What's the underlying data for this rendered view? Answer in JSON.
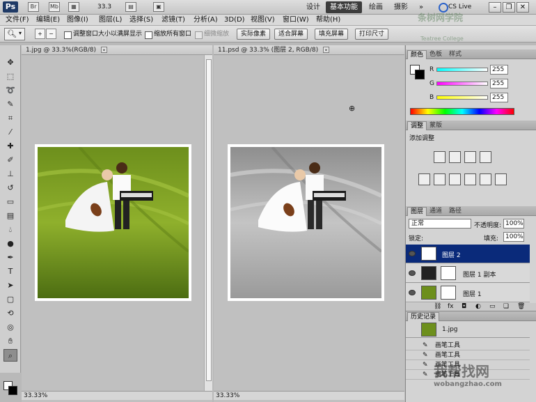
{
  "app": {
    "logo": "Ps",
    "br_icon": "Br",
    "mb_icon": "Mb",
    "zoom": "33.3",
    "workspaces": [
      "设计",
      "基本功能",
      "绘画",
      "摄影"
    ],
    "more": "»",
    "cslive": "CS Live"
  },
  "menu": [
    "文件(F)",
    "编辑(E)",
    "图像(I)",
    "图层(L)",
    "选择(S)",
    "滤镜(T)",
    "分析(A)",
    "3D(D)",
    "视图(V)",
    "窗口(W)",
    "帮助(H)"
  ],
  "options": {
    "resize_windows": "调整窗口大小以满屏显示",
    "zoom_all": "缩放所有窗口",
    "scrubby": "细微缩放",
    "actual_pixels": "实际像素",
    "fit_screen": "适合屏幕",
    "fill_screen": "填充屏幕",
    "print_size": "打印尺寸"
  },
  "doc1": {
    "title": "1.jpg @ 33.3%(RGB/8)",
    "zoom": "33.33%"
  },
  "doc2": {
    "title": "11.psd @ 33.3% (图层 2, RGB/8)",
    "zoom": "33.33%"
  },
  "color_panel": {
    "tabs": [
      "颜色",
      "色板",
      "样式"
    ],
    "r_label": "R",
    "g_label": "G",
    "b_label": "B",
    "r": "255",
    "g": "255",
    "b": "255"
  },
  "adjust_panel": {
    "tabs": [
      "调整",
      "蒙版"
    ],
    "heading": "添加调整"
  },
  "layers_panel": {
    "tabs": [
      "图层",
      "通道",
      "路径"
    ],
    "blend_mode": "正常",
    "opacity_label": "不透明度:",
    "opacity": "100%",
    "lock_label": "锁定:",
    "fill_label": "填充:",
    "fill": "100%",
    "layers": [
      "图层 2",
      "图层 1 副本",
      "图层 1"
    ]
  },
  "history_panel": {
    "tab": "历史记录",
    "snapshot": "1.jpg",
    "items": [
      "画笔工具",
      "画笔工具",
      "画笔工具",
      "画笔工具"
    ]
  },
  "watermarks": {
    "top_right": "条树网学院",
    "top_right_sub": "Teatree College",
    "bottom_right": "我帮找网",
    "bottom_url": "wobangzhao.com"
  },
  "colors": {
    "accent_active": "#3c3c3c",
    "layer_selected": "#0a2a7a",
    "grass_dark": "#4c6d12",
    "grass_light": "#8fb02c"
  }
}
